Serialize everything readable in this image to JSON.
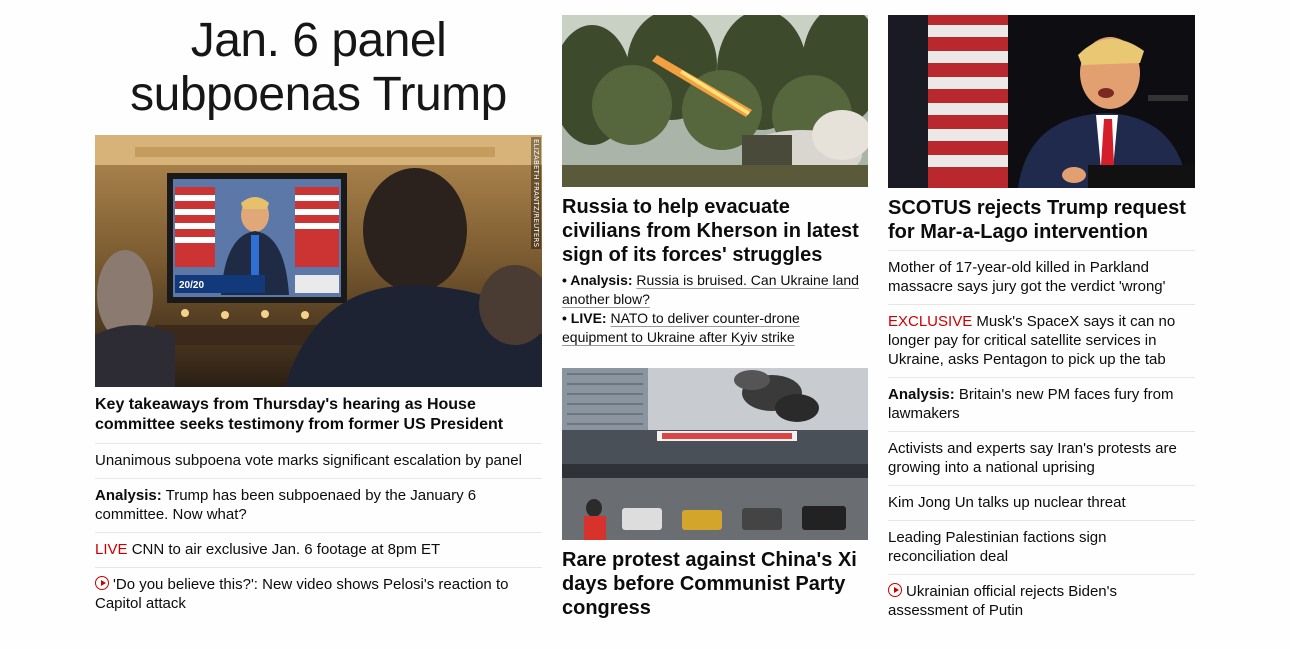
{
  "col1": {
    "banner_line1": "Jan. 6 panel",
    "banner_line2": "subpoenas Trump",
    "photo_credit": "ELIZABETH FRANTZ/REUTERS",
    "screen_caption": "20/20",
    "lead_headline": "Key takeaways from Thursday's hearing as House committee seeks testimony from former US President",
    "items": [
      {
        "prefix": "",
        "text": "Unanimous subpoena vote marks significant escalation by panel"
      },
      {
        "prefix": "Analysis:",
        "text": "Trump has been subpoenaed by the January 6 committee. Now what?"
      },
      {
        "prefix": "LIVE",
        "text": "CNN to air exclusive Jan. 6 footage at 8pm ET"
      },
      {
        "prefix": "",
        "text": "'Do you believe this?': New video shows Pelosi's reaction to Capitol attack"
      }
    ]
  },
  "col2": {
    "story1": {
      "headline": "Russia to help evacuate civilians from Kherson in latest sign of its forces' struggles",
      "sub": [
        {
          "prefix": "• Analysis:",
          "text": "Russia is bruised. Can Ukraine land another blow?"
        },
        {
          "prefix": "• LIVE:",
          "text": "NATO to deliver counter-drone equipment to Ukraine after Kyiv strike"
        }
      ]
    },
    "story2": {
      "headline": "Rare protest against China's Xi days before Communist Party congress"
    }
  },
  "col3": {
    "headline": "SCOTUS rejects Trump request for Mar-a-Lago intervention",
    "items": [
      {
        "prefix": "",
        "text": "Mother of 17-year-old killed in Parkland massacre says jury got the verdict 'wrong'"
      },
      {
        "prefix": "EXCLUSIVE",
        "text": "Musk's SpaceX says it can no longer pay for critical satellite services in Ukraine, asks Pentagon to pick up the tab"
      },
      {
        "prefix": "Analysis:",
        "text": "Britain's new PM faces fury from lawmakers"
      },
      {
        "prefix": "",
        "text": "Activists and experts say Iran's protests are growing into a national uprising"
      },
      {
        "prefix": "",
        "text": "Kim Jong Un talks up nuclear threat"
      },
      {
        "prefix": "",
        "text": "Leading Palestinian factions sign reconciliation deal"
      },
      {
        "prefix": "",
        "text": "Ukrainian official rejects Biden's assessment of Putin"
      }
    ]
  },
  "colors": {
    "accent_red": "#cc0000",
    "text": "#0c0c0c",
    "divider": "#e6e6e6"
  },
  "icons": {
    "video": "play-circle-icon"
  }
}
